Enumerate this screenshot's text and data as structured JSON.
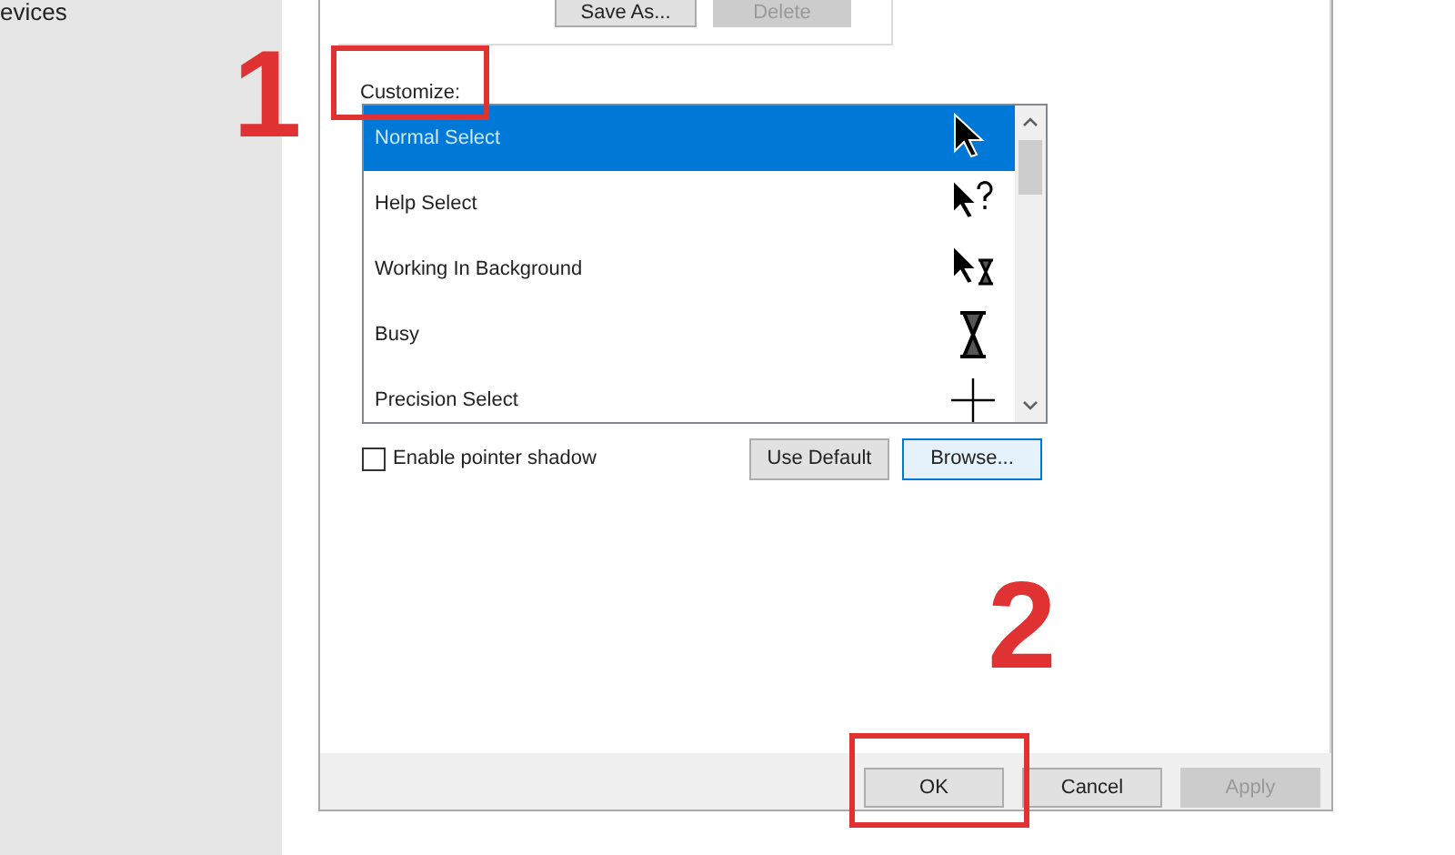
{
  "sidebar": {
    "item": "evices"
  },
  "scheme_buttons": [
    {
      "label": "Save As...",
      "disabled": false
    },
    {
      "label": "Delete",
      "disabled": true
    }
  ],
  "customize": {
    "label": "Customize:",
    "items": [
      {
        "label": "Normal Select",
        "kind": "arrow",
        "selected": true
      },
      {
        "label": "Help Select",
        "kind": "help",
        "selected": false
      },
      {
        "label": "Working In Background",
        "kind": "working",
        "selected": false
      },
      {
        "label": "Busy",
        "kind": "busy",
        "selected": false
      },
      {
        "label": "Precision Select",
        "kind": "crosshair",
        "selected": false
      }
    ]
  },
  "shadow_checkbox": {
    "label": "Enable pointer shadow",
    "checked": false
  },
  "list_buttons": [
    {
      "label": "Use Default",
      "focused": false
    },
    {
      "label": "Browse...",
      "focused": true
    }
  ],
  "dialog_buttons": [
    {
      "label": "OK",
      "disabled": false
    },
    {
      "label": "Cancel",
      "disabled": false
    },
    {
      "label": "Apply",
      "disabled": true
    }
  ],
  "annotations": [
    {
      "number": "1"
    },
    {
      "number": "2"
    }
  ]
}
